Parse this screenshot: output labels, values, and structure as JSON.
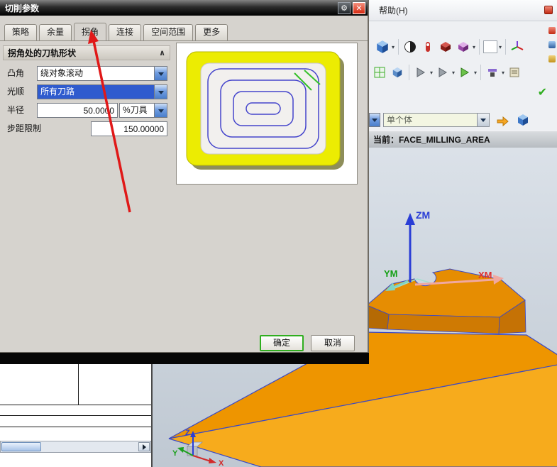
{
  "icons": {
    "gear": "⚙",
    "close": "✕",
    "chevron_up": "∧",
    "check": "✔"
  },
  "dialog": {
    "title": "切削参数",
    "tabs": [
      {
        "label": "策略"
      },
      {
        "label": "余量"
      },
      {
        "label": "拐角"
      },
      {
        "label": "连接"
      },
      {
        "label": "空间范围"
      },
      {
        "label": "更多"
      }
    ],
    "group_title": "拐角处的刀轨形状",
    "rows": {
      "convex": {
        "label": "凸角",
        "value": "绕对象滚动"
      },
      "smoothing": {
        "label": "光顺",
        "value": "所有刀路"
      },
      "radius": {
        "label": "半径",
        "value": "50.0000",
        "unit": "%刀具"
      },
      "step_limit": {
        "label": "步距限制",
        "value": "150.00000"
      }
    },
    "buttons": {
      "ok": "确定",
      "cancel": "取消"
    }
  },
  "topbar": {
    "help_menu": "帮助(H)",
    "selection_value": "单个体",
    "status": "当前：FACE_MILLING_AREA"
  },
  "viewport": {
    "axis_zm": "ZM",
    "axis_xm": "XM",
    "axis_ym": "YM",
    "triad_x": "X",
    "triad_y": "Y",
    "triad_z": "Z"
  },
  "colors": {
    "accent_blue": "#2f5bce",
    "model_orange": "#ee9500",
    "ok_green": "#2fae1f",
    "annotation_red": "#e01818"
  }
}
